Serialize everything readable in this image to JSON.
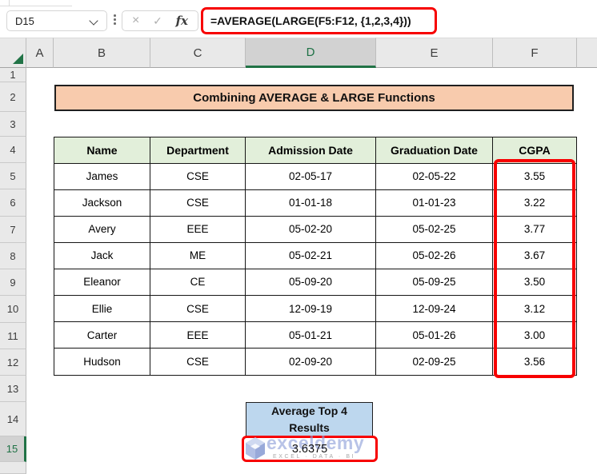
{
  "name_box": {
    "value": "D15"
  },
  "formula_bar": {
    "formula": "=AVERAGE(LARGE(F5:F12, {1,2,3,4}))",
    "cancel_glyph": "×",
    "confirm_glyph": "✓",
    "fx_glyph": "fx"
  },
  "selection": {
    "active_cell": "D15",
    "selected_column": "D",
    "selected_row": "15"
  },
  "column_headers": [
    "A",
    "B",
    "C",
    "D",
    "E",
    "F"
  ],
  "row_headers": [
    "1",
    "2",
    "3",
    "4",
    "5",
    "6",
    "7",
    "8",
    "9",
    "10",
    "11",
    "12",
    "13",
    "14",
    "15"
  ],
  "sheet": {
    "title": "Combining AVERAGE & LARGE Functions",
    "table": {
      "headers": [
        "Name",
        "Department",
        "Admission Date",
        "Graduation Date",
        "CGPA"
      ],
      "rows": [
        [
          "James",
          "CSE",
          "02-05-17",
          "02-05-22",
          "3.55"
        ],
        [
          "Jackson",
          "CSE",
          "01-01-18",
          "01-01-23",
          "3.22"
        ],
        [
          "Avery",
          "EEE",
          "05-02-20",
          "05-02-25",
          "3.77"
        ],
        [
          "Jack",
          "ME",
          "05-02-21",
          "05-02-26",
          "3.67"
        ],
        [
          "Eleanor",
          "CE",
          "05-09-20",
          "05-09-25",
          "3.50"
        ],
        [
          "Ellie",
          "CSE",
          "12-09-19",
          "12-09-24",
          "3.12"
        ],
        [
          "Carter",
          "EEE",
          "05-01-21",
          "05-01-26",
          "3.00"
        ],
        [
          "Hudson",
          "CSE",
          "02-09-20",
          "02-09-25",
          "3.56"
        ]
      ]
    },
    "result": {
      "label_line1": "Average Top 4",
      "label_line2": "Results",
      "value": "3.6375"
    }
  },
  "watermark": {
    "brand": "exceldemy",
    "tagline": "EXCEL · DATA · BI"
  },
  "colors": {
    "excel_green": "#217346",
    "title_fill": "#F8CBAD",
    "table_header_fill": "#E2EFDA",
    "result_fill": "#BDD7EE",
    "highlight_red": "#F70000",
    "header_gray": "#E9E9E9",
    "selected_header_gray": "#D2D2D2"
  }
}
